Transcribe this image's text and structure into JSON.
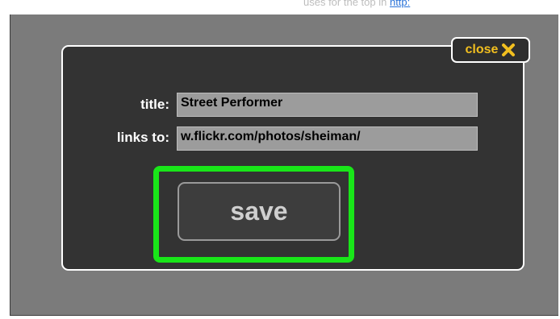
{
  "top_bar": {
    "text": "uses for the top in",
    "link_text": "http:"
  },
  "dialog": {
    "close": {
      "label": "close",
      "icon": "close-x-icon"
    },
    "fields": {
      "title": {
        "label": "title:",
        "value": "Street Performer"
      },
      "links_to": {
        "label": "links to:",
        "value": "w.flickr.com/photos/sheiman/"
      }
    },
    "save_label": "save"
  },
  "colors": {
    "background": "#7b7b7b",
    "dialog": "#333333",
    "highlight": "#19e619",
    "close_accent": "#f2bf1f",
    "field": "#9c9c9c"
  }
}
